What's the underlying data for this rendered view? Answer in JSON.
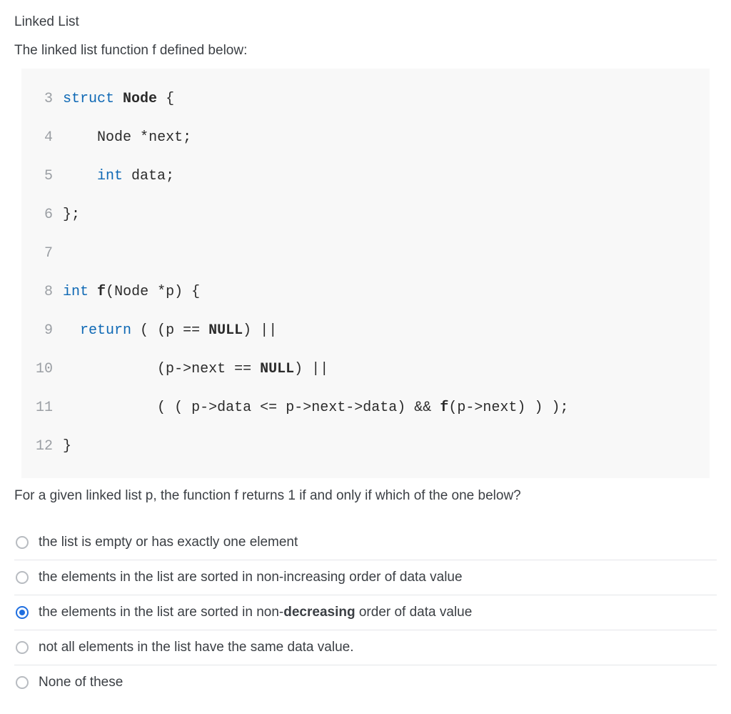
{
  "title": "Linked List",
  "prompt": "The linked list function f defined below:",
  "code_lines": [
    "3",
    "4",
    "5",
    "6",
    "7",
    "8",
    "9",
    "10",
    "11",
    "12"
  ],
  "followup": "For a given linked list p, the function f returns 1 if and only if which of the one below?",
  "options": [
    {
      "text": "the list is empty or has exactly one element",
      "selected": false
    },
    {
      "text": "the elements in the list are sorted in non-increasing order of data value",
      "selected": false
    },
    {
      "text_html": "the elements in the list are sorted in non-<strong>decreasing</strong> order of data value",
      "selected": true
    },
    {
      "text": "not all elements in the list have the same data value.",
      "selected": false
    },
    {
      "text": "None of these",
      "selected": false
    }
  ],
  "code_source": {
    "3": "struct Node {",
    "4": "    Node *next;",
    "5": "    int data;",
    "6": "};",
    "7": "",
    "8": "int f(Node *p) {",
    "9": "  return ( (p == NULL) ||",
    "10": "           (p->next == NULL) ||",
    "11": "           ( ( p->data <= p->next->data) && f(p->next) ) );",
    "12": "}"
  }
}
